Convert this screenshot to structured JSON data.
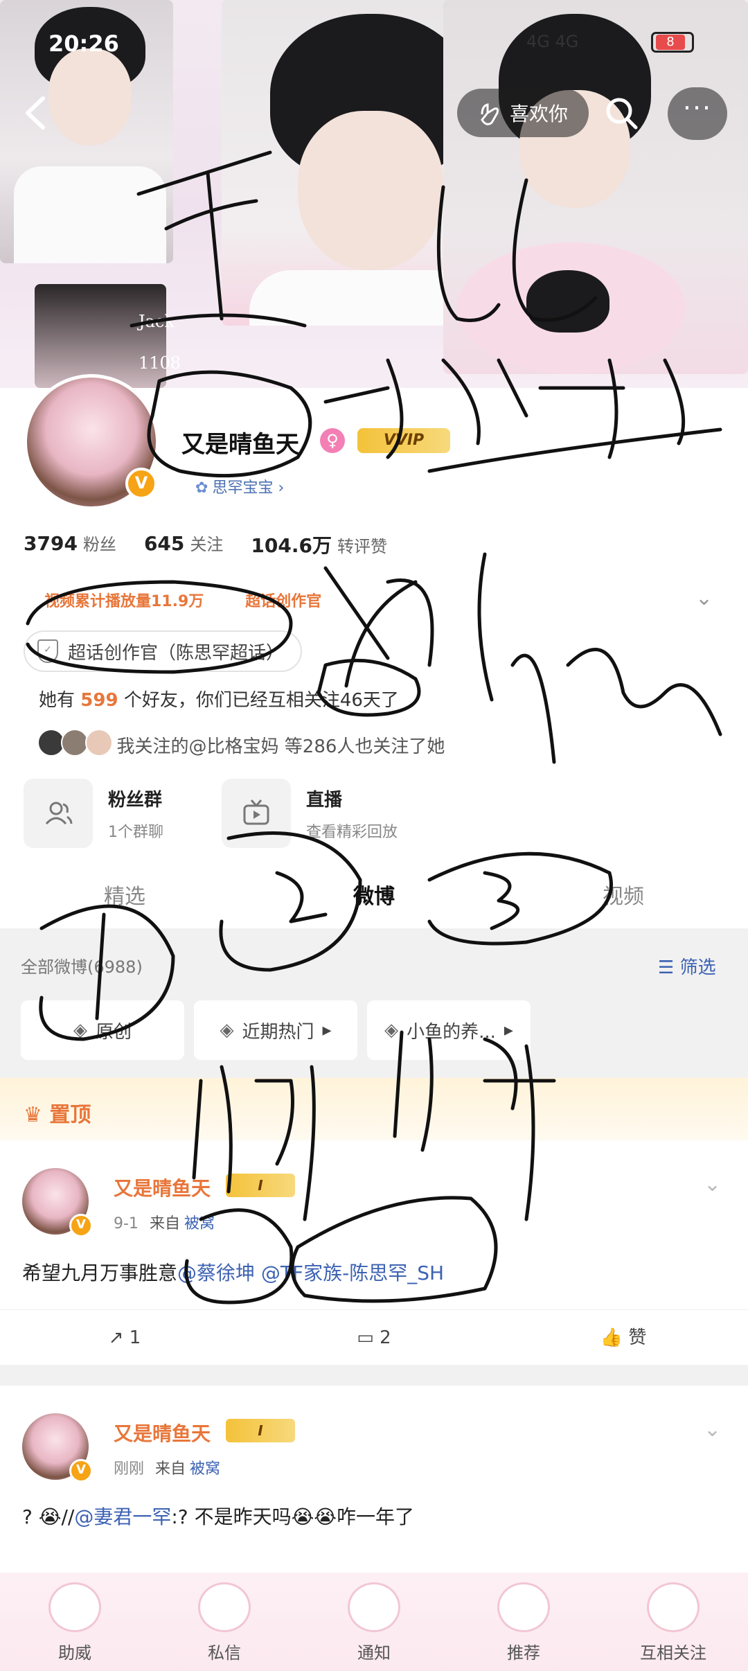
{
  "status_bar": {
    "time": "20:26",
    "network": "4G 4G",
    "battery": "8"
  },
  "header": {
    "like_label": "喜欢你",
    "more_label": "···"
  },
  "banner": {
    "thumb_text_1": "Jack",
    "thumb_text_2": "1108"
  },
  "profile": {
    "nickname": "又是晴鱼天",
    "vip_label": "VVIP",
    "fan_tag": "思罕宝宝",
    "stats": [
      {
        "value": "3794",
        "label": "粉丝"
      },
      {
        "value": "645",
        "label": "关注"
      },
      {
        "value": "104.6万",
        "label": "转评赞"
      }
    ],
    "tags": [
      "视频累计播放量11.9万",
      "超话创作官"
    ],
    "super_topic": "超话创作官（陈思罕超话）",
    "friends": {
      "prefix": "她有",
      "count": "599",
      "suffix": "个好友，你们已经互相关注46天了"
    },
    "follow_line": "我关注的@比格宝妈 等286人也关注了她"
  },
  "entries": [
    {
      "title": "粉丝群",
      "sub": "1个群聊"
    },
    {
      "title": "直播",
      "sub": "查看精彩回放"
    }
  ],
  "tabs": [
    "精选",
    "微博",
    "视频"
  ],
  "feed": {
    "all_label": "全部微博(6988)",
    "filter_label": "筛选",
    "chips": [
      "原创",
      "近期热门",
      "小鱼的养..."
    ],
    "pinned_label": "置顶"
  },
  "posts": [
    {
      "name": "又是晴鱼天",
      "badge": "I",
      "time": "9-1",
      "source_prefix": "来自",
      "device": "被窝",
      "text_plain": "希望九月万事胜意",
      "mentions": "@蔡徐坤 @TF家族-陈思罕_SH",
      "repost": "1",
      "comment": "2",
      "like": "赞"
    },
    {
      "name": "又是晴鱼天",
      "badge": "I",
      "time": "刚刚",
      "source_prefix": "来自",
      "device": "被窝",
      "text_a": "? 😭//",
      "mention": "@妻君一罕",
      "text_b": ":? 不是昨天吗😭😭咋一年了"
    }
  ],
  "bottom_nav": [
    "助威",
    "私信",
    "通知",
    "推荐",
    "互相关注"
  ],
  "colors": {
    "accent": "#e8763a",
    "link": "#3c62b3",
    "vip": "#f4c23a"
  }
}
